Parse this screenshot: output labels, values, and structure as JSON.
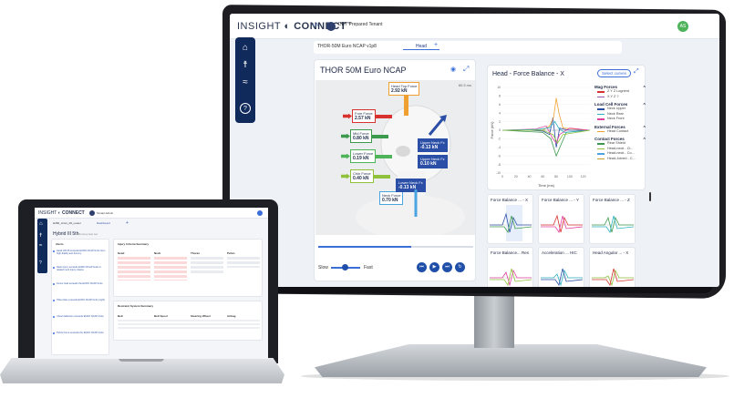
{
  "monitor": {
    "brand": "INSIGHT",
    "brand_suffix": "CONNECT",
    "brand_mark": "™",
    "tenant_code": "LA",
    "tenant_name": "DDT Prepared Tenant",
    "avatar_initials": "AS",
    "tabs": [
      {
        "label": "THOR-50M Euro NCAP v1p8",
        "active": false
      },
      {
        "label": "Head",
        "active": true
      },
      {
        "label": "+",
        "active": false
      }
    ],
    "viewer": {
      "title": "THOR 50M Euro NCAP",
      "time": "80.5 ms",
      "forces": [
        {
          "name": "Head Top Force",
          "value": "2.92 kN",
          "color": "#f0a030"
        },
        {
          "name": "Fore Force",
          "value": "2.57 kN",
          "color": "#d8322f"
        },
        {
          "name": "Mid Force",
          "value": "0.80 kN",
          "color": "#3c9a4e"
        },
        {
          "name": "Lower Force",
          "value": "0.19 kN",
          "color": "#4fb35a"
        },
        {
          "name": "Chin Force",
          "value": "0.40 kN",
          "color": "#8fc23a"
        },
        {
          "name": "Neck Force",
          "value": "0.70 kN",
          "color": "#4aa4e0"
        },
        {
          "name": "Upper Neck Fx",
          "value": "-0.13 kN",
          "color": "#2b4ea6"
        },
        {
          "name": "Upper Neck Fz",
          "value": "0.10 kN",
          "color": "#2b4ea6"
        },
        {
          "name": "Lower Neck Fx",
          "value": "-0.13 kN",
          "color": "#2b4ea6"
        }
      ],
      "playback": {
        "slow_label": "Slow",
        "fast_label": "Fast",
        "progress": 0.6
      }
    },
    "chart_panel": {
      "title": "Head - Force Balance - X",
      "select_button": "Select curves",
      "legend_groups": [
        {
          "title": "Mag Forces",
          "items": [
            {
              "label": "Z Y Z Lognent",
              "color": "#d8322f"
            },
            {
              "label": "X Y Z ?",
              "color": "#9b59b6"
            }
          ]
        },
        {
          "title": "Load Cell Forces",
          "items": [
            {
              "label": "Neck Upper",
              "color": "#2b4ea6"
            },
            {
              "label": "Neck Rear",
              "color": "#2ab0c0"
            },
            {
              "label": "Neck Front",
              "color": "#e040a0"
            }
          ]
        },
        {
          "title": "External Forces",
          "items": [
            {
              "label": "Head Contact",
              "color": "#f0a030"
            }
          ]
        },
        {
          "title": "Contact Forces",
          "items": [
            {
              "label": "Rear Shield",
              "color": "#3c9a4e"
            },
            {
              "label": "Head-neck - Ci...",
              "color": "#8fc23a"
            },
            {
              "label": "Head-neck - Co...",
              "color": "#4aa4e0"
            },
            {
              "label": "Head-Joined - C...",
              "color": "#c8a030"
            }
          ]
        }
      ]
    },
    "thumbnails": [
      {
        "title": "Force Balance ... - X"
      },
      {
        "title": "Force Balance ... - Y"
      },
      {
        "title": "Force Balance ... - Z"
      },
      {
        "title": "Force Balance... Res"
      },
      {
        "title": "Acceleration ... HIC"
      },
      {
        "title": "Head Angular ... - X"
      }
    ]
  },
  "chart_data": {
    "type": "line",
    "title": "Head - Force Balance - X",
    "xlabel": "Time (ms)",
    "ylabel": "Force (kN)",
    "x_ticks": [
      0,
      20,
      40,
      60,
      80,
      100,
      120
    ],
    "y_ticks": [
      10,
      8,
      6,
      4,
      2,
      0,
      -2,
      -4,
      -6,
      -8,
      -10
    ],
    "xlim": [
      0,
      130
    ],
    "ylim": [
      -10,
      10
    ],
    "series": [
      {
        "name": "Neck Upper",
        "color": "#2b4ea6",
        "x": [
          0,
          40,
          60,
          70,
          75,
          80,
          85,
          90,
          100,
          130
        ],
        "y": [
          0,
          0,
          -0.2,
          -1,
          3,
          -4,
          0.5,
          0.3,
          0,
          0
        ]
      },
      {
        "name": "Head Contact",
        "color": "#f0a030",
        "x": [
          0,
          60,
          70,
          76,
          80,
          84,
          90,
          130
        ],
        "y": [
          0,
          0,
          1,
          3,
          7.5,
          4,
          0.5,
          0
        ]
      },
      {
        "name": "Rear Shield",
        "color": "#3c9a4e",
        "x": [
          0,
          60,
          72,
          80,
          88,
          95,
          130
        ],
        "y": [
          0,
          -0.5,
          -2,
          -6,
          -3,
          -0.5,
          0
        ]
      },
      {
        "name": "Neck Front",
        "color": "#e040a0",
        "x": [
          0,
          50,
          65,
          75,
          80,
          85,
          100,
          130
        ],
        "y": [
          0,
          0.3,
          1,
          -2,
          -3,
          -1,
          0.5,
          0
        ]
      },
      {
        "name": "Neck Rear",
        "color": "#2ab0c0",
        "x": [
          0,
          55,
          70,
          78,
          84,
          92,
          130
        ],
        "y": [
          0,
          0.2,
          0.6,
          2,
          0.4,
          -0.5,
          0
        ]
      },
      {
        "name": "Head-neck - Ci...",
        "color": "#8fc23a",
        "x": [
          0,
          60,
          75,
          82,
          90,
          130
        ],
        "y": [
          0,
          0,
          -1,
          -3,
          -1,
          0
        ]
      }
    ]
  },
  "laptop": {
    "brand": "INSIGHT",
    "brand_suffix": "CONNECT",
    "tenant": "Tenant Admin",
    "tabs": [
      "H350_Amro_06_Lower",
      "Dashboard",
      "+"
    ],
    "test_title": "Hybrid III 5th",
    "test_sub": "Dummy test set",
    "alerts_title": "Alerts",
    "alerts": [
      "Head HIC15 exceeds EURO NCAP limits from high-fidelity test dummy",
      "Neck Injury exceeds EURO NCAP limits in related neck injury criteria",
      "Femur load exceeds the EURO NCAP limits",
      "Tibia index exceeds EURO NCAP limits (right)",
      "Chest deflection exceeds EURO NCAP limits",
      "Pelvis Force exceeds the EURO NCAP limits"
    ],
    "summary_title": "Injury Criteria Summary",
    "summary_cols": [
      "Head",
      "Neck",
      "Thorax",
      "Pelvis"
    ],
    "restraint_title": "Restraint System Summary",
    "restraint_cols": [
      "Belt",
      "Belt Spool",
      "Steering Wheel",
      "Airbag"
    ]
  }
}
